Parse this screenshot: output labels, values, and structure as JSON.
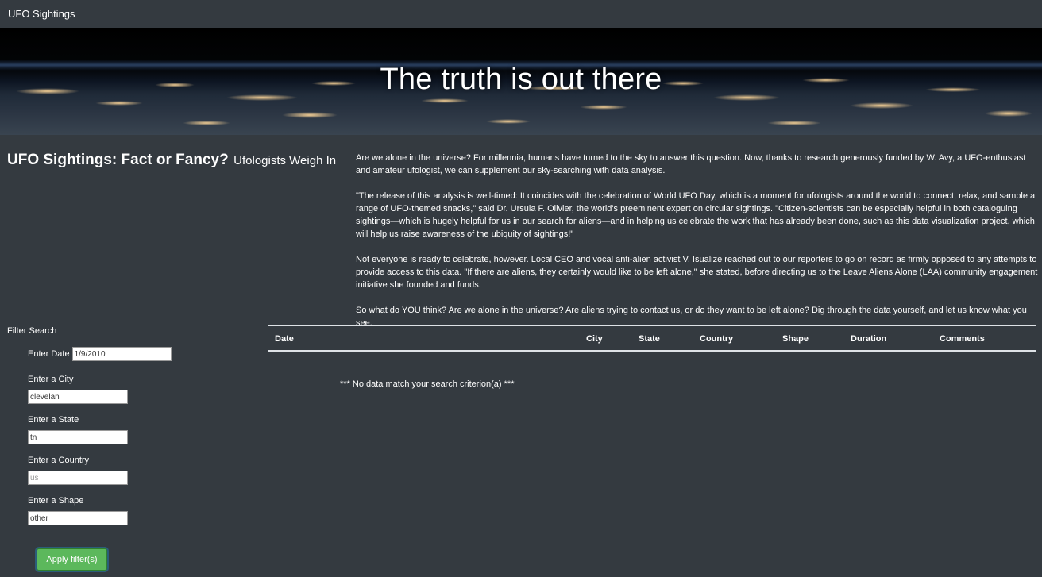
{
  "navbar": {
    "brand": "UFO Sightings"
  },
  "hero": {
    "title": "The truth is out there"
  },
  "article": {
    "title": "UFO Sightings: Fact or Fancy?",
    "subtitle": "Ufologists Weigh In",
    "paragraphs": [
      "Are we alone in the universe? For millennia, humans have turned to the sky to answer this question. Now, thanks to research generously funded by W. Avy, a UFO-enthusiast and amateur ufologist, we can supplement our sky-searching with data analysis.",
      "\"The release of this analysis is well-timed: It coincides with the celebration of World UFO Day, which is a moment for ufologists around the world to connect, relax, and sample a range of UFO-themed snacks,\" said Dr. Ursula F. Olivier, the world's preeminent expert on circular sightings. \"Citizen-scientists can be especially helpful in both cataloguing sightings—which is hugely helpful for us in our search for aliens—and in helping us celebrate the work that has already been done, such as this data visualization project, which will help us raise awareness of the ubiquity of sightings!\"",
      "Not everyone is ready to celebrate, however. Local CEO and vocal anti-alien activist V. Isualize reached out to our reporters to go on record as firmly opposed to any attempts to provide access to this data. \"If there are aliens, they certainly would like to be left alone,\" she stated, before directing us to the Leave Aliens Alone (LAA) community engagement initiative she founded and funds.",
      "So what do YOU think? Are we alone in the universe? Are aliens trying to contact us, or do they want to be left alone? Dig through the data yourself, and let us know what you see."
    ]
  },
  "filters": {
    "title": "Filter Search",
    "date": {
      "label": "Enter Date",
      "value": "1/9/2010"
    },
    "city": {
      "label": "Enter a City",
      "value": "clevelan"
    },
    "state": {
      "label": "Enter a State",
      "value": "tn"
    },
    "country": {
      "label": "Enter a Country",
      "placeholder": "us"
    },
    "shape": {
      "label": "Enter a Shape",
      "value": "other"
    },
    "apply_label": "Apply filter(s)"
  },
  "table": {
    "columns": [
      "Date",
      "City",
      "State",
      "Country",
      "Shape",
      "Duration",
      "Comments"
    ],
    "empty_message": "*** No data match your search criterion(a) ***"
  },
  "colors": {
    "background": "#343a40",
    "button": "#5cb85c",
    "text": "#ffffff"
  }
}
